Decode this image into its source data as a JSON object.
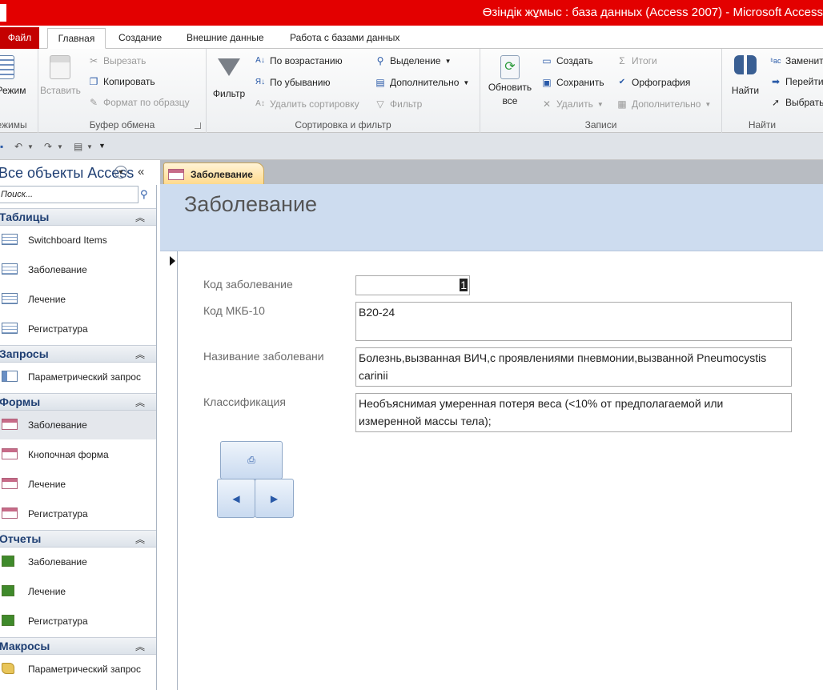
{
  "window": {
    "title": "Өзіндік жұмыс : база данных (Access 2007)  -  Microsoft Access"
  },
  "ribbon_tabs": {
    "file": "Файл",
    "home": "Главная",
    "create": "Создание",
    "external": "Внешние данные",
    "database": "Работа с базами данных"
  },
  "ribbon": {
    "views": {
      "button": "Режим",
      "label": "Режимы"
    },
    "clipboard": {
      "paste": "Вставить",
      "cut": "Вырезать",
      "copy": "Копировать",
      "format_painter": "Формат по образцу",
      "label": "Буфер обмена"
    },
    "sort_filter": {
      "filter": "Фильтр",
      "ascending": "По возрастанию",
      "descending": "По убыванию",
      "remove_sort": "Удалить сортировку",
      "selection": "Выделение",
      "advanced": "Дополнительно",
      "toggle_filter": "Фильтр",
      "label": "Сортировка и фильтр"
    },
    "records": {
      "refresh_line1": "Обновить",
      "refresh_line2": "все",
      "new": "Создать",
      "save": "Сохранить",
      "delete": "Удалить",
      "totals": "Итоги",
      "spelling": "Орфография",
      "more": "Дополнительно",
      "label": "Записи"
    },
    "find": {
      "find": "Найти",
      "replace": "Заменить",
      "goto": "Перейти",
      "select": "Выбрать",
      "label": "Найти"
    }
  },
  "nav": {
    "title": "Все объекты Access",
    "search_placeholder": "Поиск...",
    "sections": [
      {
        "label": "Таблицы",
        "items": [
          "Switchboard Items",
          "Заболевание",
          "Лечение",
          "Регистратура"
        ]
      },
      {
        "label": "Запросы",
        "items": [
          "Параметрический запрос"
        ]
      },
      {
        "label": "Формы",
        "items": [
          "Заболевание",
          "Кнопочная форма",
          "Лечение",
          "Регистратура"
        ]
      },
      {
        "label": "Отчеты",
        "items": [
          "Заболевание",
          "Лечение",
          "Регистратура"
        ]
      },
      {
        "label": "Макросы",
        "items": [
          "Параметрический запрос"
        ]
      }
    ]
  },
  "document": {
    "tab_label": "Заболевание",
    "form_title": "Заболевание",
    "fields": [
      {
        "label": "Код заболевание",
        "value": "1"
      },
      {
        "label": "Код МКБ-10",
        "value": "B20-24"
      },
      {
        "label": "Називание заболевани",
        "value": "Болезнь,вызванная ВИЧ,с проявлениями пневмонии,вызванной Pneumocystis carinii"
      },
      {
        "label": "Классификация",
        "value": "Необъяснимая умеренная потеря веса (<10% от предполагаемой или измеренной массы тела);"
      }
    ]
  }
}
